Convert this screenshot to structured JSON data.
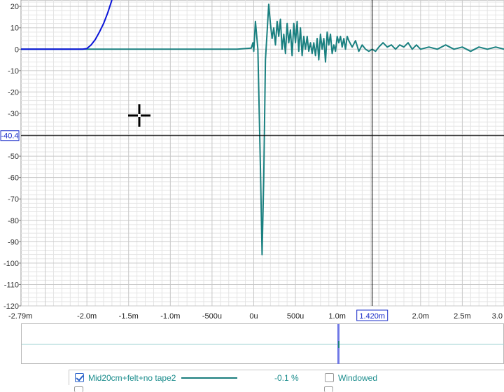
{
  "chart_data": {
    "type": "line",
    "x_unit": "seconds",
    "x_tick_labels": [
      "-2.79m",
      "-2.0m",
      "-1.5m",
      "-1.0m",
      "-500u",
      "0u",
      "500u",
      "1.0m",
      "2.0m",
      "2.5m",
      "3.0"
    ],
    "x_ticks": [
      -0.00279,
      -0.002,
      -0.0015,
      -0.001,
      -0.0005,
      0,
      0.0005,
      0.001,
      0.002,
      0.0025,
      0.003
    ],
    "y_tick_labels": [
      "20",
      "10",
      "0",
      "-10",
      "-20",
      "-30",
      "-50",
      "-60",
      "-70",
      "-80",
      "-90",
      "-100",
      "-110",
      "-120"
    ],
    "y_ticks": [
      20,
      10,
      0,
      -10,
      -20,
      -30,
      -50,
      -60,
      -70,
      -80,
      -90,
      -100,
      -110,
      -120
    ],
    "xlim": [
      -0.00279,
      0.003
    ],
    "ylim": [
      -120,
      23
    ],
    "grid": true,
    "cursor": {
      "x": 0.00142,
      "y": -40.4,
      "x_label": "1.420m",
      "y_label": "-40.4"
    },
    "series": [
      {
        "name": "Mid20cm+felt+no tape2",
        "color": "#1a8080",
        "points": [
          [
            -0.00279,
            0
          ],
          [
            -0.0002,
            0
          ],
          [
            -3e-05,
            0.5
          ],
          [
            -1e-05,
            3
          ],
          [
            0.0,
            -1
          ],
          [
            2e-05,
            13
          ],
          [
            5e-05,
            0
          ],
          [
            8e-05,
            -55
          ],
          [
            0.0001,
            -96
          ],
          [
            0.00012,
            -60
          ],
          [
            0.00014,
            -5
          ],
          [
            0.00016,
            8
          ],
          [
            0.00018,
            21
          ],
          [
            0.0002,
            12
          ],
          [
            0.00022,
            5
          ],
          [
            0.00024,
            10
          ],
          [
            0.00026,
            2
          ],
          [
            0.00028,
            13
          ],
          [
            0.0003,
            6
          ],
          [
            0.00032,
            14
          ],
          [
            0.00034,
            0
          ],
          [
            0.00036,
            7
          ],
          [
            0.00038,
            -2
          ],
          [
            0.0004,
            12
          ],
          [
            0.00042,
            3
          ],
          [
            0.00044,
            9
          ],
          [
            0.00046,
            -3
          ],
          [
            0.00048,
            12
          ],
          [
            0.0005,
            3
          ],
          [
            0.00052,
            13
          ],
          [
            0.00054,
            -1
          ],
          [
            0.00056,
            10
          ],
          [
            0.00058,
            -3
          ],
          [
            0.0006,
            6
          ],
          [
            0.00062,
            0
          ],
          [
            0.00064,
            6
          ],
          [
            0.00066,
            -1
          ],
          [
            0.00068,
            3
          ],
          [
            0.0007,
            -2
          ],
          [
            0.00072,
            3
          ],
          [
            0.00074,
            -3
          ],
          [
            0.00076,
            5
          ],
          [
            0.00078,
            -5
          ],
          [
            0.0008,
            7
          ],
          [
            0.00082,
            0
          ],
          [
            0.00084,
            5
          ],
          [
            0.00086,
            -6
          ],
          [
            0.00088,
            8
          ],
          [
            0.0009,
            2
          ],
          [
            0.00092,
            7
          ],
          [
            0.00094,
            -2
          ],
          [
            0.00096,
            2
          ],
          [
            0.00098,
            -1
          ],
          [
            0.001,
            6
          ],
          [
            0.00102,
            3
          ],
          [
            0.00104,
            6
          ],
          [
            0.00106,
            1
          ],
          [
            0.00108,
            5
          ],
          [
            0.0011,
            0
          ],
          [
            0.00112,
            6
          ],
          [
            0.00114,
            4
          ],
          [
            0.00118,
            1
          ],
          [
            0.00122,
            4
          ],
          [
            0.00126,
            -1
          ],
          [
            0.0013,
            2
          ],
          [
            0.00134,
            0
          ],
          [
            0.00138,
            -1
          ],
          [
            0.00142,
            0
          ],
          [
            0.00146,
            -1
          ],
          [
            0.0015,
            1
          ],
          [
            0.00155,
            3
          ],
          [
            0.0016,
            1
          ],
          [
            0.00165,
            2
          ],
          [
            0.0017,
            0
          ],
          [
            0.00175,
            2
          ],
          [
            0.0018,
            1
          ],
          [
            0.00185,
            3
          ],
          [
            0.0019,
            0
          ],
          [
            0.00195,
            2
          ],
          [
            0.002,
            0
          ],
          [
            0.0021,
            1
          ],
          [
            0.0022,
            0
          ],
          [
            0.0023,
            2
          ],
          [
            0.0024,
            0
          ],
          [
            0.0025,
            1
          ],
          [
            0.0026,
            -1
          ],
          [
            0.0027,
            1
          ],
          [
            0.0028,
            0
          ],
          [
            0.0029,
            1
          ],
          [
            0.003,
            0
          ]
        ]
      },
      {
        "name": "",
        "color": "#0a14d8",
        "points": [
          [
            -0.00279,
            0
          ],
          [
            -0.00205,
            0
          ],
          [
            -0.002,
            0.3
          ],
          [
            -0.00195,
            2
          ],
          [
            -0.0019,
            4.5
          ],
          [
            -0.00185,
            8
          ],
          [
            -0.0018,
            12
          ],
          [
            -0.00175,
            17
          ],
          [
            -0.0017,
            23
          ]
        ]
      }
    ]
  },
  "legend": {
    "entry_label": "Mid20cm+felt+no tape2",
    "entry_checked": true,
    "entry_value": "-0.1 %",
    "windowed_label": "Windowed",
    "windowed_checked": false
  },
  "colors": {
    "grid_major": "#c8c8c8",
    "grid_minor": "#e4e4e4",
    "cursor": "#000000",
    "cursor_label_border": "#1a2cc8",
    "overview_line": "#9dd0d0"
  }
}
